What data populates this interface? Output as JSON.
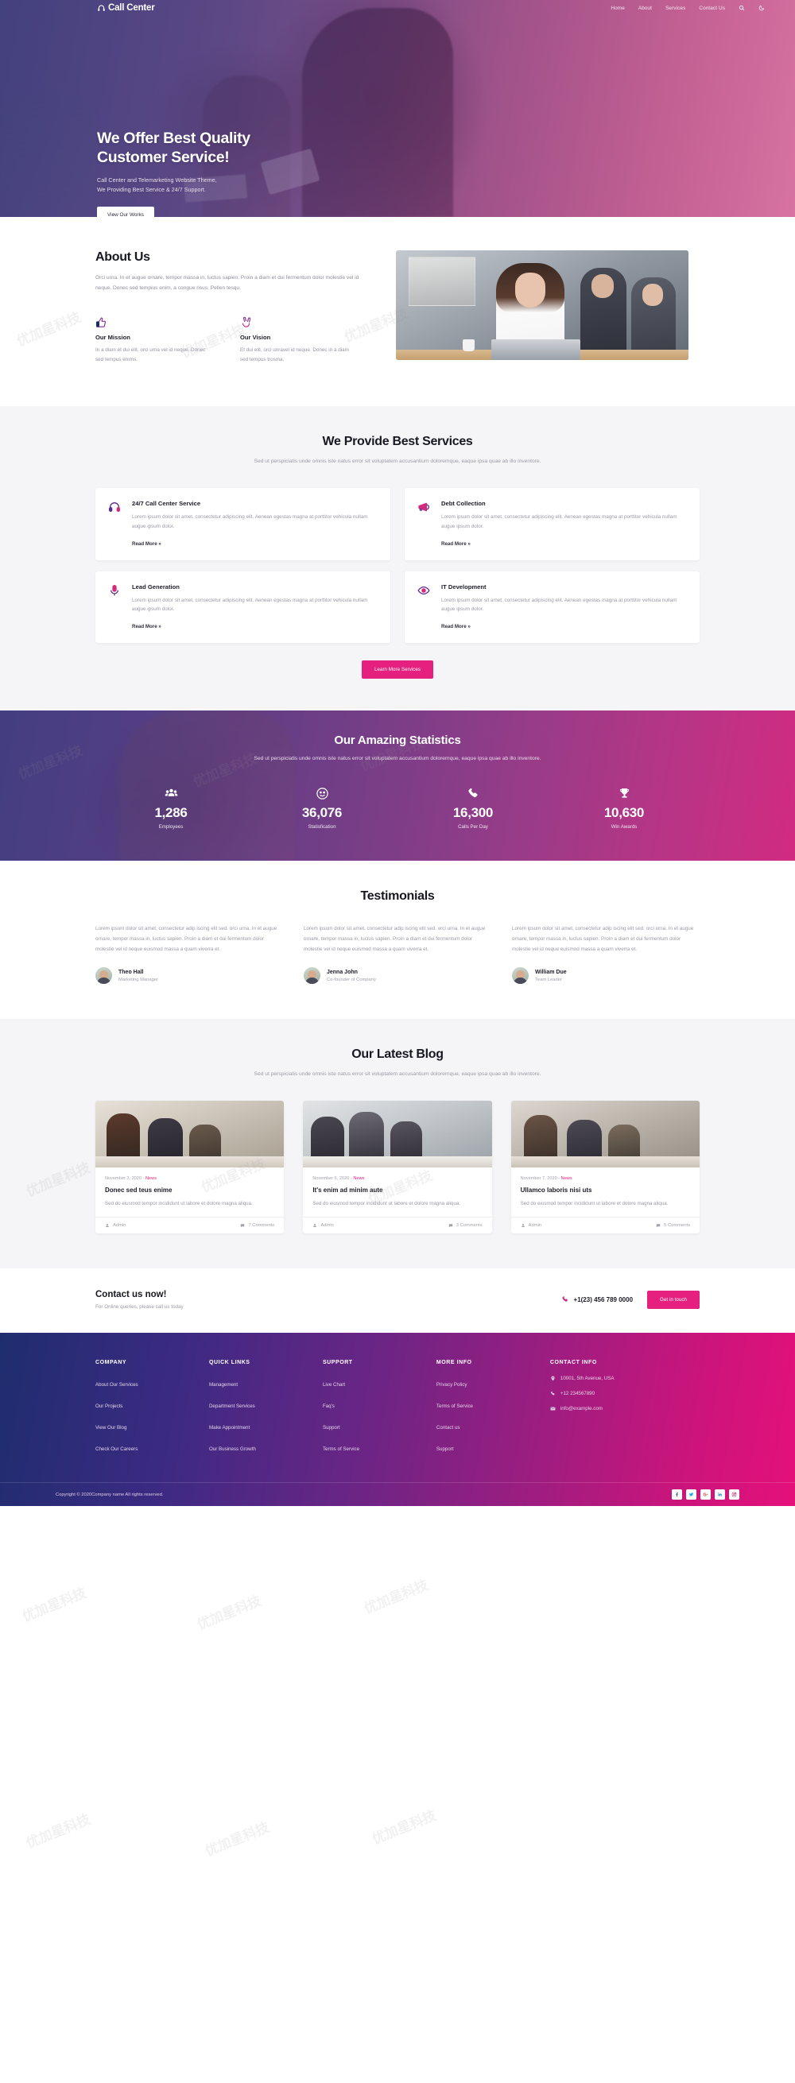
{
  "nav": {
    "brand": "Call Center",
    "links": [
      "Home",
      "About",
      "Services",
      "Contact Us"
    ],
    "search_icon": "search-icon",
    "theme_icon": "moon-icon"
  },
  "hero": {
    "title_line1": "We Offer Best Quality",
    "title_line2": "Customer Service!",
    "sub_line1": "Call Center and Telemarketing Website Theme,",
    "sub_line2": "We Providing Best Service & 24/7 Support.",
    "button": "View Our Works"
  },
  "about": {
    "title": "About Us",
    "text": "Orci urna. In et augue ornare, tempor massa in, luctus sapien. Proin a diam et dui fermentum dolor molestie vel id neque. Donec sed tempius enim, a congue risus. Pellen tesqu.",
    "features": [
      {
        "icon": "thumbs-up-icon",
        "title": "Our Mission",
        "text": "In a diam et dui elit, orci urna vel id neque. Donec sed tempus enims."
      },
      {
        "icon": "peace-hand-icon",
        "title": "Our Vision",
        "text": "Et dui elit, orci unravel id neque. Donec in a diam sed tempus trosma."
      }
    ]
  },
  "services": {
    "title": "We Provide Best Services",
    "subtitle": "Sed ut perspiciatis unde omnis iste natus error sit voluptatem accusantium doloremque, eaque ipsa quae ab illo inventore.",
    "cards": [
      {
        "icon": "headset-icon",
        "title": "24/7 Call Center Service",
        "text": "Lorem ipsum dolor sit amet, consectetur adipiscing elit. Aenean egestas magna at porttitor vehicula nullam augue ipsum dolor.",
        "link": "Read More »"
      },
      {
        "icon": "megaphone-icon",
        "title": "Debt Collection",
        "text": "Lorem ipsum dolor sit amet, consectetur adipiscing elit. Aenean egestas magna at porttitor vehicula nullam augue ipsum dolor.",
        "link": "Read More »"
      },
      {
        "icon": "mic-icon",
        "title": "Lead Generation",
        "text": "Lorem ipsum dolor sit amet, consectetur adipiscing elit. Aenean egestas magna at porttitor vehicula nullam augue ipsum dolor.",
        "link": "Read More »"
      },
      {
        "icon": "eye-icon",
        "title": "IT Development",
        "text": "Lorem ipsum dolor sit amet, consectetur adipiscing elit. Aenean egestas magna at porttitor vehicula nullam augue ipsum dolor.",
        "link": "Read More »"
      }
    ],
    "button": "Learn More Services"
  },
  "stats": {
    "title": "Our Amazing Statistics",
    "subtitle": "Sed ut perspiciatis unde omnis iste natus error sit voluptatem accusantium doloremque, eaque ipsa quae ab illo inventore.",
    "items": [
      {
        "icon": "users-icon",
        "value": "1,286",
        "label": "Employees"
      },
      {
        "icon": "smiley-icon",
        "value": "36,076",
        "label": "Statisfication"
      },
      {
        "icon": "phone-icon",
        "value": "16,300",
        "label": "Calls Per Day"
      },
      {
        "icon": "trophy-icon",
        "value": "10,630",
        "label": "Win Awards"
      }
    ]
  },
  "testimonials": {
    "title": "Testimonials",
    "items": [
      {
        "text": "Lorem ipsum dolor sit amet, consectetur adip iscing elit sed. orci urna. In et augue ornare, tempor massa in, luctus sapien. Proin a diam et dui fermentum dolor molestie vel id neque euismod massa a quam viverra et.",
        "name": "Theo Hall",
        "role": "Marketing Manager"
      },
      {
        "text": "Lorem ipsum dolor sit amet, consectetur adip iscing elit sed. orci urna. In et augue ornare, tempor massa in, luctus sapien. Proin a diam et dui fermentum dolor molestie vel id neque euismod massa a quam viverra et.",
        "name": "Jenna John",
        "role": "Co-founder of Company"
      },
      {
        "text": "Lorem ipsum dolor sit amet, consectetur adip iscing elit sed. orci urna. In et augue ornare, tempor massa in, luctus sapien. Proin a diam et dui fermentum dolor molestie vel id neque euismod massa a quam viverra et.",
        "name": "William Due",
        "role": "Team Leader"
      }
    ]
  },
  "blog": {
    "title": "Our Latest Blog",
    "subtitle": "Sed ut perspiciatis unde omnis iste natus error sit voluptatem accusantium doloremque, eaque ipsa quae ab illo inventore.",
    "posts": [
      {
        "date": "November 3, 2020 -",
        "category": "News",
        "title": "Donec sed teus enime",
        "text": "Sed do eiusmod tempor incididunt ut labore et dolore magna aliqua.",
        "author": "Admin",
        "comments": "7 Comments"
      },
      {
        "date": "November 6, 2020 -",
        "category": "News",
        "title": "It's enim ad minim aute",
        "text": "Sed do eiusmod tempor incididunt ut labore et dolore magna aliqua.",
        "author": "Admin",
        "comments": "3 Comments"
      },
      {
        "date": "November 7, 2020 -",
        "category": "News",
        "title": "Ullamco laboris nisi uts",
        "text": "Sed do eiusmod tempor incididunt ut labore et dolore magna aliqua.",
        "author": "Admin",
        "comments": "5 Comments"
      }
    ]
  },
  "contact": {
    "title": "Contact us now!",
    "subtitle": "For Online queries, please call us today",
    "phone": "+1(23) 456 789 0000",
    "button": "Get in touch"
  },
  "footer": {
    "columns": [
      {
        "heading": "COMPANY",
        "links": [
          "About Our Services",
          "Our Projects",
          "View Our Blog",
          "Check Our Careers"
        ]
      },
      {
        "heading": "QUICK LINKS",
        "links": [
          "Management",
          "Department Services",
          "Make Appointment",
          "Our Business Growth"
        ]
      },
      {
        "heading": "SUPPORT",
        "links": [
          "Live Chart",
          "Faq's",
          "Support",
          "Terms of Service"
        ]
      },
      {
        "heading": "MORE INFO",
        "links": [
          "Privacy Policy",
          "Terms of Service",
          "Contact us",
          "Support"
        ]
      }
    ],
    "contact_heading": "CONTACT INFO",
    "contact_items": [
      {
        "icon": "location-icon",
        "text": "10001, 5th Avenue, USA"
      },
      {
        "icon": "phone-icon",
        "text": "+12 234567890"
      },
      {
        "icon": "mail-icon",
        "text": "info@example.com"
      }
    ],
    "copyright": "Copyright © 2020Company name All rights reserved.",
    "socials": [
      "facebook-icon",
      "twitter-icon",
      "google-plus-icon",
      "linkedin-icon",
      "instagram-icon"
    ]
  },
  "watermark": "优加星科技",
  "colors": {
    "accent_pink": "#e5207e",
    "accent_purple": "#6a2585"
  }
}
